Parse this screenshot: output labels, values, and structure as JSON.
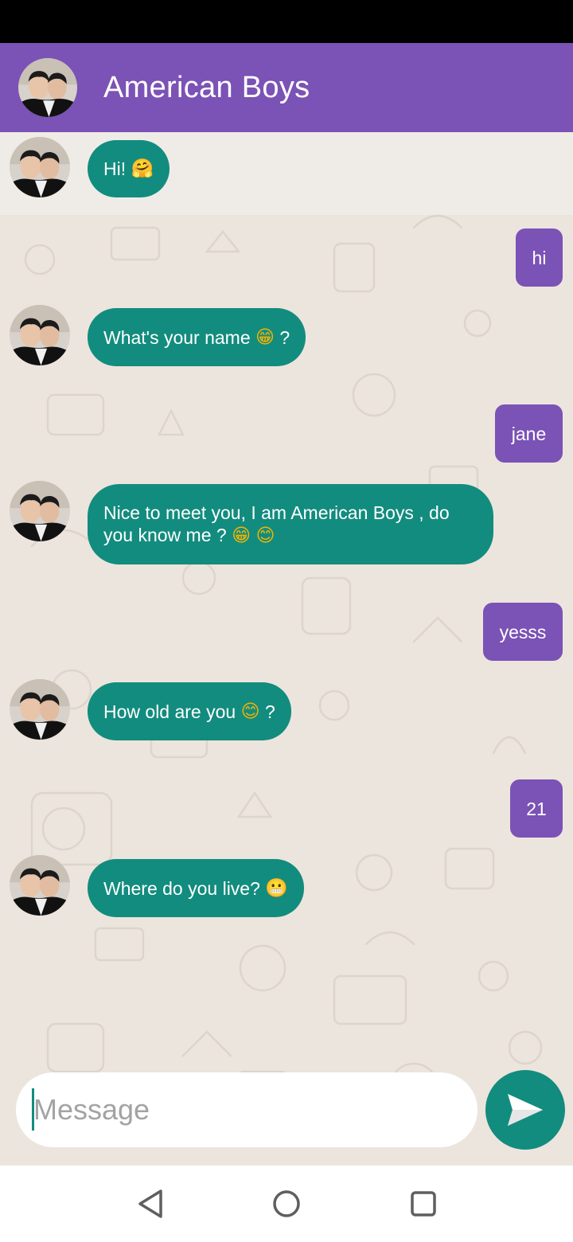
{
  "header": {
    "title": "American Boys",
    "avatar_alt": "American Boys avatar"
  },
  "messages": [
    {
      "from": "bot",
      "text": "Hi!",
      "emoji": "🤗"
    },
    {
      "from": "user",
      "text": "hi"
    },
    {
      "from": "bot",
      "text": "What's your name",
      "emoji": "😁",
      "suffix": "?"
    },
    {
      "from": "user",
      "text": "jane"
    },
    {
      "from": "bot",
      "line1": "Nice to meet you, I am American Boys , do",
      "line2": "you know me  ?",
      "emoji1": "😁",
      "emoji2": "😊"
    },
    {
      "from": "user",
      "text": "yesss"
    },
    {
      "from": "bot",
      "text": "How old are you",
      "emoji": "😊",
      "suffix": "?"
    },
    {
      "from": "user",
      "text": "21"
    },
    {
      "from": "bot",
      "text": "Where do you live?",
      "emoji": "😬"
    }
  ],
  "composer": {
    "placeholder": "Message"
  },
  "icons": {
    "send": "send-icon",
    "back": "back-triangle-icon",
    "home": "home-circle-icon",
    "recents": "recents-square-icon"
  },
  "colors": {
    "app_bar": "#7b52b5",
    "bot_bubble": "#128c7e",
    "user_bubble": "#7b52b5",
    "chat_background": "#ece5dd"
  }
}
